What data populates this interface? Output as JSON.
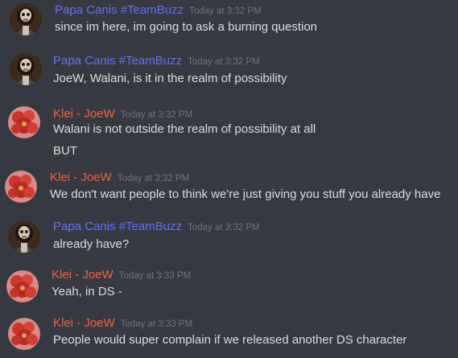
{
  "colors": {
    "background": "#36393f",
    "author_papa": "#6971f7",
    "author_klei": "#f0624c",
    "timestamp": "#72767d",
    "message_text": "#dcddde"
  },
  "messages": [
    {
      "author": "Papa Canis #TeamBuzz",
      "author_color": "#6971f7",
      "avatar_icon": "skull-portrait-icon",
      "timestamp": "Today at 3:32 PM",
      "lines": [
        "since im here, im going to ask a burning question"
      ]
    },
    {
      "author": "Papa Canis #TeamBuzz",
      "author_color": "#6971f7",
      "avatar_icon": "skull-portrait-icon",
      "timestamp": "Today at 3:32 PM",
      "lines": [
        "JoeW, Walani, is it in the realm of possibility"
      ]
    },
    {
      "author": "Klei - JoeW",
      "author_color": "#f0624c",
      "avatar_icon": "red-flower-icon",
      "timestamp": "Today at 3:32 PM",
      "lines": [
        "Walani is not outside the realm of possibility at all",
        "BUT"
      ]
    },
    {
      "author": "Klei - JoeW",
      "author_color": "#f0624c",
      "avatar_icon": "red-flower-icon",
      "timestamp": "Today at 3:32 PM",
      "lines": [
        "We don't want people to think we're just giving you stuff you already have"
      ]
    },
    {
      "author": "Papa Canis #TeamBuzz",
      "author_color": "#6971f7",
      "avatar_icon": "skull-portrait-icon",
      "timestamp": "Today at 3:32 PM",
      "lines": [
        "already have?"
      ]
    },
    {
      "author": "Klei - JoeW",
      "author_color": "#f0624c",
      "avatar_icon": "red-flower-icon",
      "timestamp": "Today at 3:33 PM",
      "lines": [
        "Yeah, in DS -"
      ]
    },
    {
      "author": "Klei - JoeW",
      "author_color": "#f0624c",
      "avatar_icon": "red-flower-icon",
      "timestamp": "Today at 3:33 PM",
      "lines": [
        "People would super complain if we released another DS character"
      ]
    }
  ]
}
